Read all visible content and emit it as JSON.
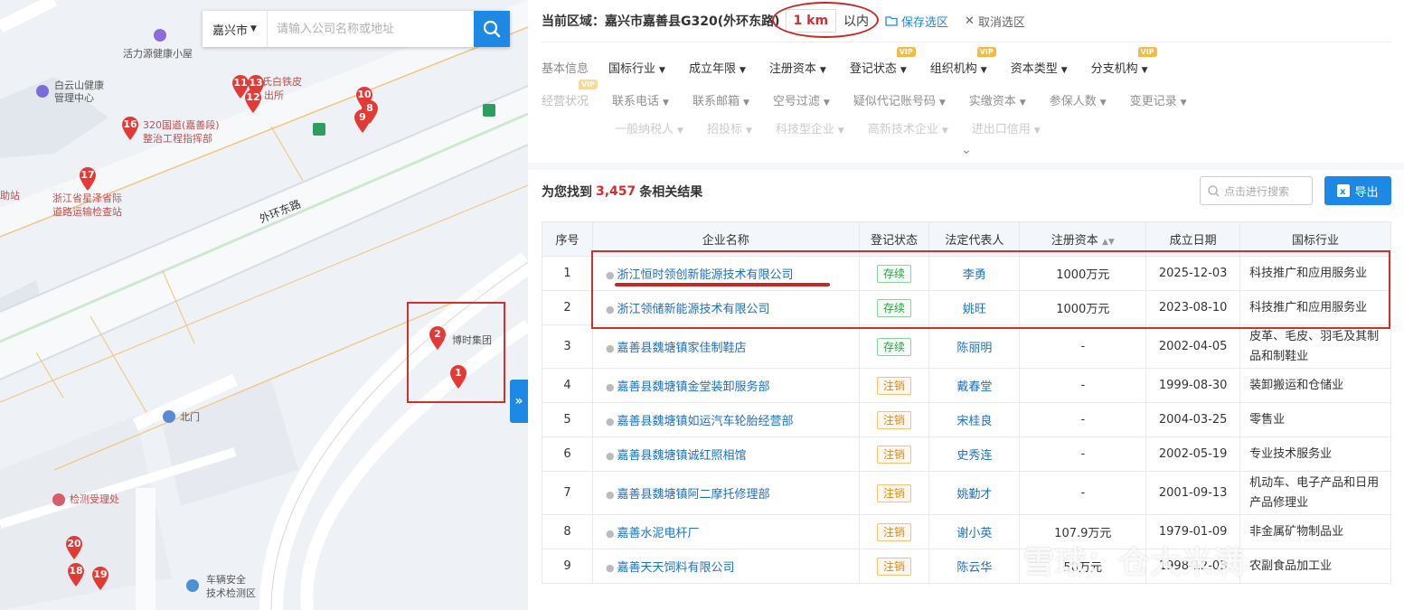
{
  "map": {
    "search": {
      "city": "嘉兴市",
      "placeholder": "请输入公司名称或地址"
    },
    "poi_labels": [
      {
        "text": "活力源健康小屋",
        "style": "dark"
      },
      {
        "text": "白云山健康",
        "style": "dark"
      },
      {
        "text": "管理中心",
        "style": "dark"
      },
      {
        "text": "氏白铁皮",
        "style": "red"
      },
      {
        "text": "出所",
        "style": "red"
      },
      {
        "text": "320国道(嘉善段)",
        "style": "red"
      },
      {
        "text": "整治工程指挥部",
        "style": "red"
      },
      {
        "text": "浙江省星泽省际",
        "style": "red"
      },
      {
        "text": "道路运输检查站",
        "style": "red"
      },
      {
        "text": "助站",
        "style": "red"
      },
      {
        "text": "外环东路",
        "style": "road"
      },
      {
        "text": "博时集团",
        "style": "dark"
      },
      {
        "text": "北门",
        "style": "dark"
      },
      {
        "text": "检测受理处",
        "style": "red"
      },
      {
        "text": "车辆安全",
        "style": "dark"
      },
      {
        "text": "技术检测区",
        "style": "dark"
      }
    ],
    "pins": [
      "11",
      "13",
      "12",
      "16",
      "17",
      "10",
      "8",
      "9",
      "2",
      "1",
      "20",
      "18",
      "19"
    ],
    "collapse_glyph": "»"
  },
  "panel": {
    "area": {
      "label": "当前区域：嘉兴市嘉善县G320(外环东路)",
      "radius": "1 km",
      "within": "以内",
      "save": "保存选区",
      "cancel": "取消选区"
    },
    "filters_row1": {
      "head": "基本信息",
      "items": [
        "国标行业",
        "成立年限",
        "注册资本",
        "登记状态",
        "组织机构",
        "资本类型",
        "分支机构"
      ],
      "vip": [
        false,
        false,
        false,
        true,
        true,
        false,
        true
      ]
    },
    "filters_row2": {
      "head": "经营状况",
      "items": [
        "联系电话",
        "联系邮箱",
        "空号过滤",
        "疑似代记账号码",
        "实缴资本",
        "参保人数",
        "变更记录"
      ]
    },
    "filters_row3": {
      "items": [
        "一般纳税人",
        "招投标",
        "科技型企业",
        "高新技术企业",
        "进出口信用"
      ]
    },
    "vip_text": "VIP",
    "result": {
      "prefix": "为您找到",
      "count": "3,457",
      "suffix": "条相关结果"
    },
    "search_placeholder": "点击进行搜索",
    "export_label": "导出",
    "table": {
      "headers": [
        "序号",
        "企业名称",
        "登记状态",
        "法定代表人",
        "注册资本",
        "成立日期",
        "国标行业"
      ],
      "rows": [
        {
          "no": "1",
          "name": "浙江恒时领创新能源技术有限公司",
          "status": "存续",
          "status_type": "active",
          "person": "李勇",
          "capital": "1000万元",
          "date": "2025-12-03",
          "industry": "科技推广和应用服务业"
        },
        {
          "no": "2",
          "name": "浙江领储新能源技术有限公司",
          "status": "存续",
          "status_type": "active",
          "person": "姚旺",
          "capital": "1000万元",
          "date": "2023-08-10",
          "industry": "科技推广和应用服务业"
        },
        {
          "no": "3",
          "name": "嘉善县魏塘镇家佳制鞋店",
          "status": "存续",
          "status_type": "active",
          "person": "陈丽明",
          "capital": "-",
          "date": "2002-04-05",
          "industry": "皮革、毛皮、羽毛及其制品和制鞋业"
        },
        {
          "no": "4",
          "name": "嘉善县魏塘镇金堂装卸服务部",
          "status": "注销",
          "status_type": "cancel",
          "person": "戴春堂",
          "capital": "-",
          "date": "1999-08-30",
          "industry": "装卸搬运和仓储业"
        },
        {
          "no": "5",
          "name": "嘉善县魏塘镇如运汽车轮胎经营部",
          "status": "注销",
          "status_type": "cancel",
          "person": "宋桂良",
          "capital": "-",
          "date": "2004-03-25",
          "industry": "零售业"
        },
        {
          "no": "6",
          "name": "嘉善县魏塘镇诚红照相馆",
          "status": "注销",
          "status_type": "cancel",
          "person": "史秀连",
          "capital": "-",
          "date": "2002-05-19",
          "industry": "专业技术服务业"
        },
        {
          "no": "7",
          "name": "嘉善县魏塘镇阿二摩托修理部",
          "status": "注销",
          "status_type": "cancel",
          "person": "姚勤才",
          "capital": "-",
          "date": "2001-09-13",
          "industry": "机动车、电子产品和日用产品修理业"
        },
        {
          "no": "8",
          "name": "嘉善水泥电杆厂",
          "status": "注销",
          "status_type": "cancel",
          "person": "谢小英",
          "capital": "107.9万元",
          "date": "1979-01-09",
          "industry": "非金属矿物制品业"
        },
        {
          "no": "9",
          "name": "嘉善天天饲料有限公司",
          "status": "注销",
          "status_type": "cancel",
          "person": "陈云华",
          "capital": "50万元",
          "date": "1998-12-03",
          "industry": "农副食品加工业"
        }
      ]
    },
    "watermark": "雪球：仓大米满"
  }
}
